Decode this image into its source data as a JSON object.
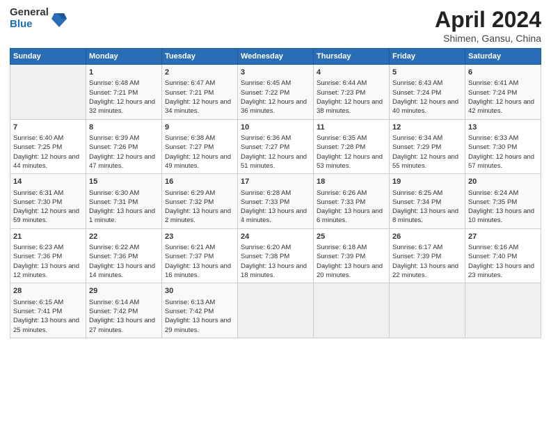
{
  "logo": {
    "general": "General",
    "blue": "Blue"
  },
  "title": "April 2024",
  "subtitle": "Shimen, Gansu, China",
  "headers": [
    "Sunday",
    "Monday",
    "Tuesday",
    "Wednesday",
    "Thursday",
    "Friday",
    "Saturday"
  ],
  "rows": [
    [
      {
        "day": "",
        "sunrise": "",
        "sunset": "",
        "daylight": "",
        "empty": true
      },
      {
        "day": "1",
        "sunrise": "Sunrise: 6:48 AM",
        "sunset": "Sunset: 7:21 PM",
        "daylight": "Daylight: 12 hours and 32 minutes."
      },
      {
        "day": "2",
        "sunrise": "Sunrise: 6:47 AM",
        "sunset": "Sunset: 7:21 PM",
        "daylight": "Daylight: 12 hours and 34 minutes."
      },
      {
        "day": "3",
        "sunrise": "Sunrise: 6:45 AM",
        "sunset": "Sunset: 7:22 PM",
        "daylight": "Daylight: 12 hours and 36 minutes."
      },
      {
        "day": "4",
        "sunrise": "Sunrise: 6:44 AM",
        "sunset": "Sunset: 7:23 PM",
        "daylight": "Daylight: 12 hours and 38 minutes."
      },
      {
        "day": "5",
        "sunrise": "Sunrise: 6:43 AM",
        "sunset": "Sunset: 7:24 PM",
        "daylight": "Daylight: 12 hours and 40 minutes."
      },
      {
        "day": "6",
        "sunrise": "Sunrise: 6:41 AM",
        "sunset": "Sunset: 7:24 PM",
        "daylight": "Daylight: 12 hours and 42 minutes."
      }
    ],
    [
      {
        "day": "7",
        "sunrise": "Sunrise: 6:40 AM",
        "sunset": "Sunset: 7:25 PM",
        "daylight": "Daylight: 12 hours and 44 minutes."
      },
      {
        "day": "8",
        "sunrise": "Sunrise: 6:39 AM",
        "sunset": "Sunset: 7:26 PM",
        "daylight": "Daylight: 12 hours and 47 minutes."
      },
      {
        "day": "9",
        "sunrise": "Sunrise: 6:38 AM",
        "sunset": "Sunset: 7:27 PM",
        "daylight": "Daylight: 12 hours and 49 minutes."
      },
      {
        "day": "10",
        "sunrise": "Sunrise: 6:36 AM",
        "sunset": "Sunset: 7:27 PM",
        "daylight": "Daylight: 12 hours and 51 minutes."
      },
      {
        "day": "11",
        "sunrise": "Sunrise: 6:35 AM",
        "sunset": "Sunset: 7:28 PM",
        "daylight": "Daylight: 12 hours and 53 minutes."
      },
      {
        "day": "12",
        "sunrise": "Sunrise: 6:34 AM",
        "sunset": "Sunset: 7:29 PM",
        "daylight": "Daylight: 12 hours and 55 minutes."
      },
      {
        "day": "13",
        "sunrise": "Sunrise: 6:33 AM",
        "sunset": "Sunset: 7:30 PM",
        "daylight": "Daylight: 12 hours and 57 minutes."
      }
    ],
    [
      {
        "day": "14",
        "sunrise": "Sunrise: 6:31 AM",
        "sunset": "Sunset: 7:30 PM",
        "daylight": "Daylight: 12 hours and 59 minutes."
      },
      {
        "day": "15",
        "sunrise": "Sunrise: 6:30 AM",
        "sunset": "Sunset: 7:31 PM",
        "daylight": "Daylight: 13 hours and 1 minute."
      },
      {
        "day": "16",
        "sunrise": "Sunrise: 6:29 AM",
        "sunset": "Sunset: 7:32 PM",
        "daylight": "Daylight: 13 hours and 2 minutes."
      },
      {
        "day": "17",
        "sunrise": "Sunrise: 6:28 AM",
        "sunset": "Sunset: 7:33 PM",
        "daylight": "Daylight: 13 hours and 4 minutes."
      },
      {
        "day": "18",
        "sunrise": "Sunrise: 6:26 AM",
        "sunset": "Sunset: 7:33 PM",
        "daylight": "Daylight: 13 hours and 6 minutes."
      },
      {
        "day": "19",
        "sunrise": "Sunrise: 6:25 AM",
        "sunset": "Sunset: 7:34 PM",
        "daylight": "Daylight: 13 hours and 8 minutes."
      },
      {
        "day": "20",
        "sunrise": "Sunrise: 6:24 AM",
        "sunset": "Sunset: 7:35 PM",
        "daylight": "Daylight: 13 hours and 10 minutes."
      }
    ],
    [
      {
        "day": "21",
        "sunrise": "Sunrise: 6:23 AM",
        "sunset": "Sunset: 7:36 PM",
        "daylight": "Daylight: 13 hours and 12 minutes."
      },
      {
        "day": "22",
        "sunrise": "Sunrise: 6:22 AM",
        "sunset": "Sunset: 7:36 PM",
        "daylight": "Daylight: 13 hours and 14 minutes."
      },
      {
        "day": "23",
        "sunrise": "Sunrise: 6:21 AM",
        "sunset": "Sunset: 7:37 PM",
        "daylight": "Daylight: 13 hours and 16 minutes."
      },
      {
        "day": "24",
        "sunrise": "Sunrise: 6:20 AM",
        "sunset": "Sunset: 7:38 PM",
        "daylight": "Daylight: 13 hours and 18 minutes."
      },
      {
        "day": "25",
        "sunrise": "Sunrise: 6:18 AM",
        "sunset": "Sunset: 7:39 PM",
        "daylight": "Daylight: 13 hours and 20 minutes."
      },
      {
        "day": "26",
        "sunrise": "Sunrise: 6:17 AM",
        "sunset": "Sunset: 7:39 PM",
        "daylight": "Daylight: 13 hours and 22 minutes."
      },
      {
        "day": "27",
        "sunrise": "Sunrise: 6:16 AM",
        "sunset": "Sunset: 7:40 PM",
        "daylight": "Daylight: 13 hours and 23 minutes."
      }
    ],
    [
      {
        "day": "28",
        "sunrise": "Sunrise: 6:15 AM",
        "sunset": "Sunset: 7:41 PM",
        "daylight": "Daylight: 13 hours and 25 minutes."
      },
      {
        "day": "29",
        "sunrise": "Sunrise: 6:14 AM",
        "sunset": "Sunset: 7:42 PM",
        "daylight": "Daylight: 13 hours and 27 minutes."
      },
      {
        "day": "30",
        "sunrise": "Sunrise: 6:13 AM",
        "sunset": "Sunset: 7:42 PM",
        "daylight": "Daylight: 13 hours and 29 minutes."
      },
      {
        "day": "",
        "sunrise": "",
        "sunset": "",
        "daylight": "",
        "empty": true
      },
      {
        "day": "",
        "sunrise": "",
        "sunset": "",
        "daylight": "",
        "empty": true
      },
      {
        "day": "",
        "sunrise": "",
        "sunset": "",
        "daylight": "",
        "empty": true
      },
      {
        "day": "",
        "sunrise": "",
        "sunset": "",
        "daylight": "",
        "empty": true
      }
    ]
  ]
}
